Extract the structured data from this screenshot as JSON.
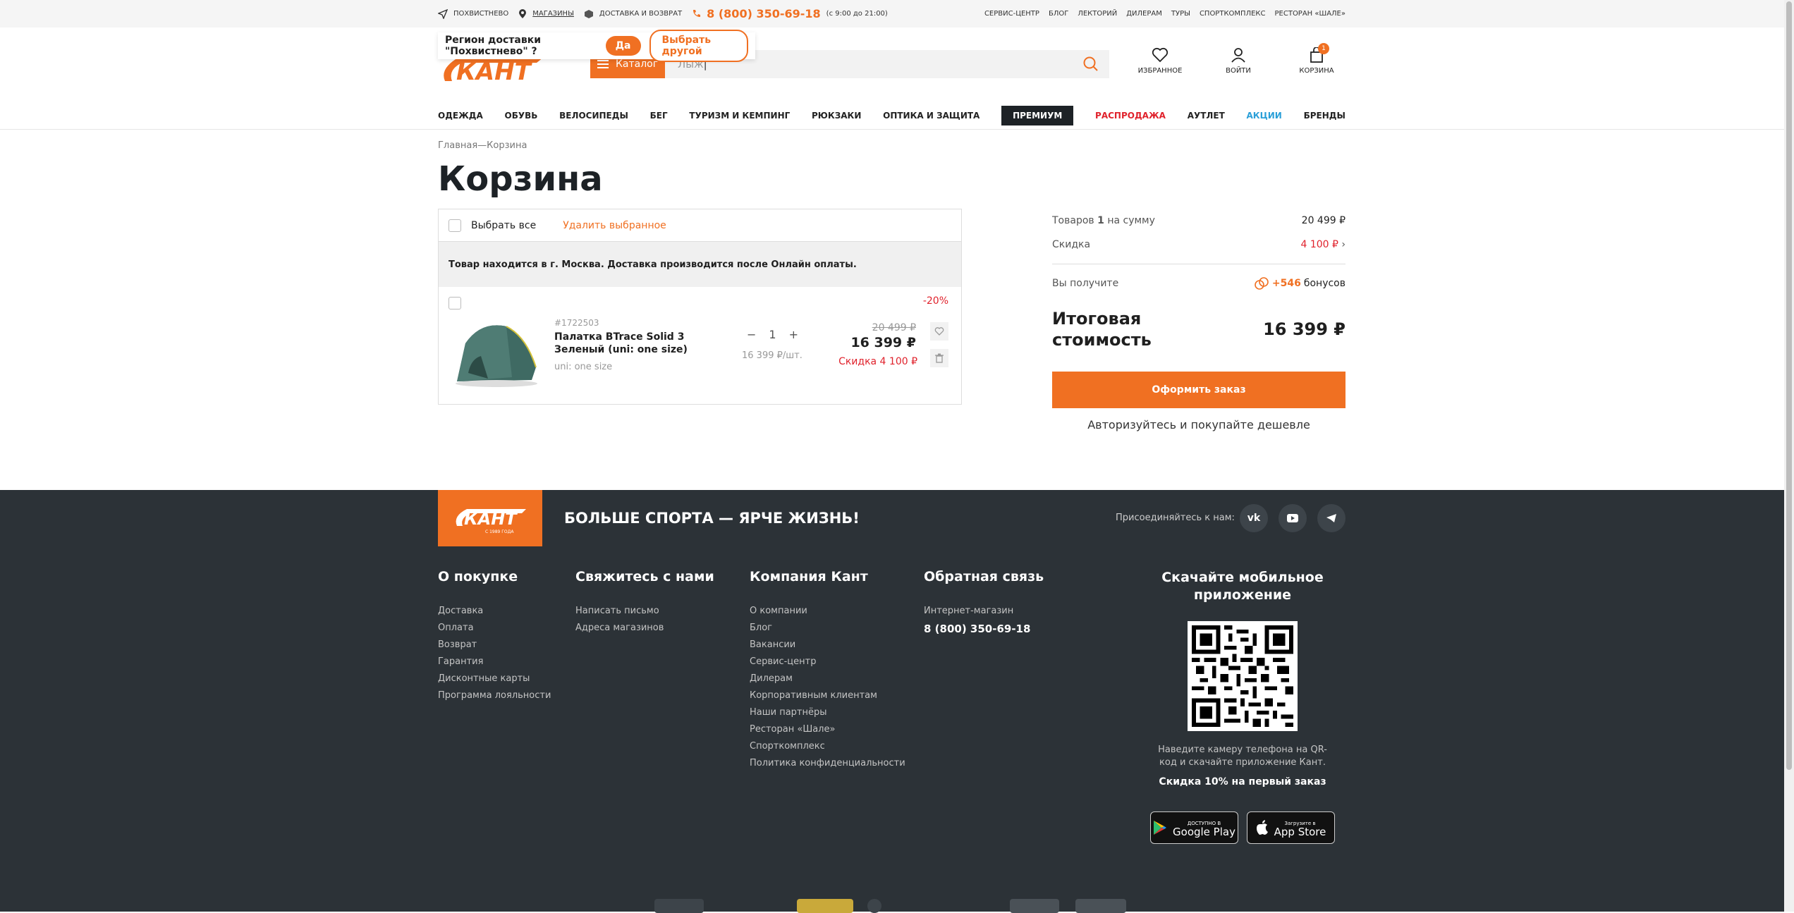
{
  "topbar": {
    "city": "Похвистнево",
    "stores": "Магазины",
    "delivery": "Доставка и возврат",
    "phone": "8 (800) 350-69-18",
    "hours": "(с 9:00 до 21:00)",
    "links": [
      "Сервис-центр",
      "Блог",
      "Лекторий",
      "Дилерам",
      "Туры",
      "Спорткомплекс",
      "Ресторан «Шале»"
    ]
  },
  "region": {
    "question": "Регион доставки \"Похвистнево\" ?",
    "yes": "Да",
    "other": "Выбрать другой"
  },
  "header": {
    "logo": "КАНТ",
    "catalog": "Каталог",
    "search_value": "Лыж",
    "favorites": "Избранное",
    "login": "Войти",
    "cart": "Корзина",
    "cart_count": "1"
  },
  "nav": [
    "Одежда",
    "Обувь",
    "Велосипеды",
    "Бег",
    "Туризм и кемпинг",
    "Рюкзаки",
    "Оптика и защита",
    "Премиум",
    "Распродажа",
    "Аутлет",
    "Акции",
    "Бренды"
  ],
  "breadcrumb": "Главная—Корзина",
  "title": "Корзина",
  "cart": {
    "select_all": "Выбрать все",
    "delete_selected": "Удалить выбранное",
    "notice": "Товар находится в г. Москва. Доставка производится после Онлайн оплаты.",
    "item": {
      "discount": "-20%",
      "article": "#1722503",
      "name": "Палатка BTrace Solid 3 Зеленый (uni: one size)",
      "size": "uni: one size",
      "qty": "1",
      "unit_price": "16 399 ₽/шт.",
      "old_price": "20 499 ₽",
      "price": "16 399 ₽",
      "saving": "Скидка 4 100 ₽"
    }
  },
  "summary": {
    "items_label_pre": "Товаров",
    "items_count": "1",
    "items_label_post": "на сумму",
    "items_sum": "20 499 ₽",
    "discount_label": "Скидка",
    "discount_value": "4 100 ₽",
    "bonus_label": "Вы получите",
    "bonus_value": "+546",
    "bonus_word": "бонусов",
    "total_label": "Итоговая стоимость",
    "total_value": "16 399 ₽",
    "order_button": "Оформить заказ",
    "auth_text": "Авторизуйтесь и покупайте дешевле"
  },
  "footer": {
    "logo": "КАНТ",
    "logo_sub": "С 1989 ГОДА",
    "slogan": "БОЛЬШЕ СПОРТА — ЯРЧЕ ЖИЗНЬ!",
    "join": "Присоединяйтесь к нам:",
    "columns": [
      {
        "title": "О покупке",
        "links": [
          "Доставка",
          "Оплата",
          "Возврат",
          "Гарантия",
          "Дисконтные карты",
          "Программа лояльности"
        ]
      },
      {
        "title": "Свяжитесь с нами",
        "links": [
          "Написать письмо",
          "Адреса магазинов"
        ]
      },
      {
        "title": "Компания Кант",
        "links": [
          "О компании",
          "Блог",
          "Вакансии",
          "Сервис-центр",
          "Дилерам",
          "Корпоративным клиентам",
          "Наши партнёры",
          "Ресторан «Шале»",
          "Спорткомплекс",
          "Политика конфиденциальности"
        ]
      },
      {
        "title": "Обратная связь",
        "links": [
          "Интернет-магазин"
        ]
      }
    ],
    "feedback_phone": "8 (800) 350-69-18",
    "app": {
      "title": "Скачайте мобильное приложение",
      "hint": "Наведите камеру телефона на QR-код и скачайте приложение Кант.",
      "discount": "Скидка 10% на первый заказ",
      "google_small": "ДОСТУПНО В",
      "google": "Google Play",
      "apple_small": "Загрузите в",
      "apple": "App Store"
    }
  },
  "colors": {
    "accent": "#f07022",
    "dark": "#2c3237",
    "sale": "#e0222c",
    "promo": "#2a9fd8"
  }
}
